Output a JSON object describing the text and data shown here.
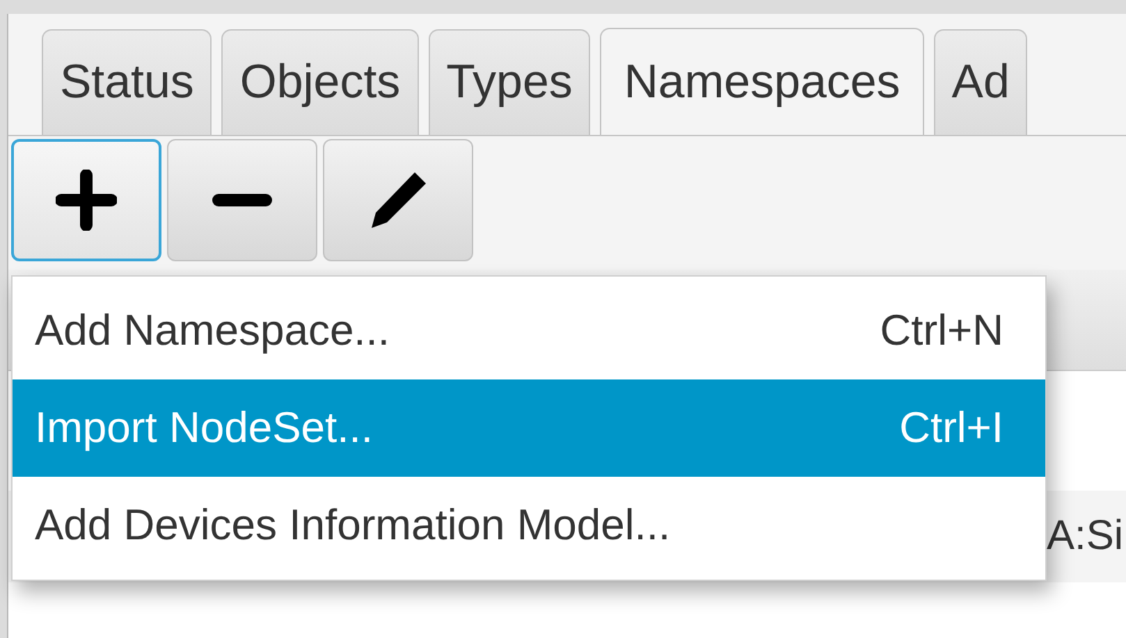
{
  "tabs": [
    {
      "label": "Status",
      "selected": false
    },
    {
      "label": "Objects",
      "selected": false
    },
    {
      "label": "Types",
      "selected": false
    },
    {
      "label": "Namespaces",
      "selected": true
    },
    {
      "label": "Ad",
      "selected": false
    }
  ],
  "toolbar": [
    {
      "kind": "add",
      "focused": true
    },
    {
      "kind": "remove",
      "focused": false
    },
    {
      "kind": "edit",
      "focused": false
    }
  ],
  "menu": [
    {
      "label": "Add Namespace...",
      "shortcut": "Ctrl+N",
      "selected": false
    },
    {
      "label": "Import NodeSet...",
      "shortcut": "Ctrl+I",
      "selected": true
    },
    {
      "label": "Add Devices Information Model...",
      "selected": false
    }
  ],
  "table": {
    "rows": [
      {
        "column_1": "A:Si"
      }
    ]
  }
}
